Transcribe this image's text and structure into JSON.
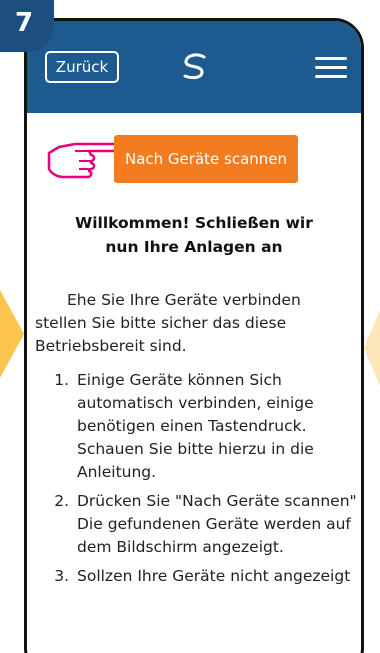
{
  "step_number": "7",
  "header": {
    "back_label": "Zurück",
    "logo_icon": "swirl-logo-icon",
    "menu_icon": "hamburger-menu-icon",
    "bg_color": "#1c5a8f"
  },
  "scan_button": {
    "label": "Nach Geräte scannen",
    "color": "#f47c20"
  },
  "welcome": {
    "line1": "Willkommen! Schließen wir",
    "line2": "nun Ihre Anlagen an"
  },
  "intro": {
    "line1": "Ehe Sie Ihre Geräte verbinden",
    "line2": "stellen Sie bitte sicher das diese",
    "line3": "Betriebsbereit sind."
  },
  "steps": [
    {
      "num": "1.",
      "text": "Einige Geräte können Sich automatisch verbinden, einige benötigen einen Tastendruck. Schauen Sie bitte hierzu in die Anleitung."
    },
    {
      "num": "2.",
      "text": "Drücken Sie \"Nach Geräte scannen\" Die gefundenen Geräte werden auf dem Bildschirm angezeigt."
    },
    {
      "num": "3.",
      "text": "Sollzen Ihre Geräte nicht angezeigt"
    }
  ]
}
